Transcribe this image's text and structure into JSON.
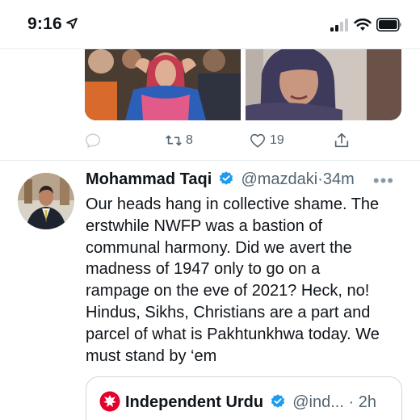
{
  "status_bar": {
    "time": "9:16",
    "icons": [
      "location-arrow-icon",
      "cellular-signal-icon",
      "wifi-icon",
      "battery-icon"
    ]
  },
  "previous_tweet": {
    "retweet_count": "8",
    "like_count": "19",
    "icons": [
      "reply-icon",
      "retweet-icon",
      "like-icon",
      "share-icon"
    ]
  },
  "tweet": {
    "author_name": "Mohammad Taqi",
    "handle": "@mazdaki",
    "separator": "·",
    "time_ago": "34m",
    "more": "•••",
    "text": "Our heads hang in collective shame. The erstwhile NWFP was a bastion of communal harmony. Did we avert the madness of 1947 only to go on a rampage on the eve of 2021? Heck, no! Hindus, Sikhs, Christians are a part and parcel of what is Pakhtunkhwa today. We must stand by ‘em",
    "text_lines": [
      "Our heads hang in collective shame. The",
      "erstwhile NWFP was a bastion of",
      "communal harmony. Did we avert the",
      "madness of 1947 only to go on a",
      "rampage on the eve of 2021? Heck, no!",
      "Hindus, Sikhs, Christians are a part and",
      "parcel of what is Pakhtunkhwa today. We",
      "must stand by ‘em"
    ]
  },
  "quoted_tweet": {
    "author_name": "Independent Urdu",
    "handle": "@ind...",
    "separator": "·",
    "time_ago": "2h"
  },
  "colors": {
    "text_primary": "#0f1419",
    "text_secondary": "#536471",
    "verified_blue": "#1d9bf0",
    "independent_red": "#e4002b",
    "border": "#cfd9de"
  }
}
